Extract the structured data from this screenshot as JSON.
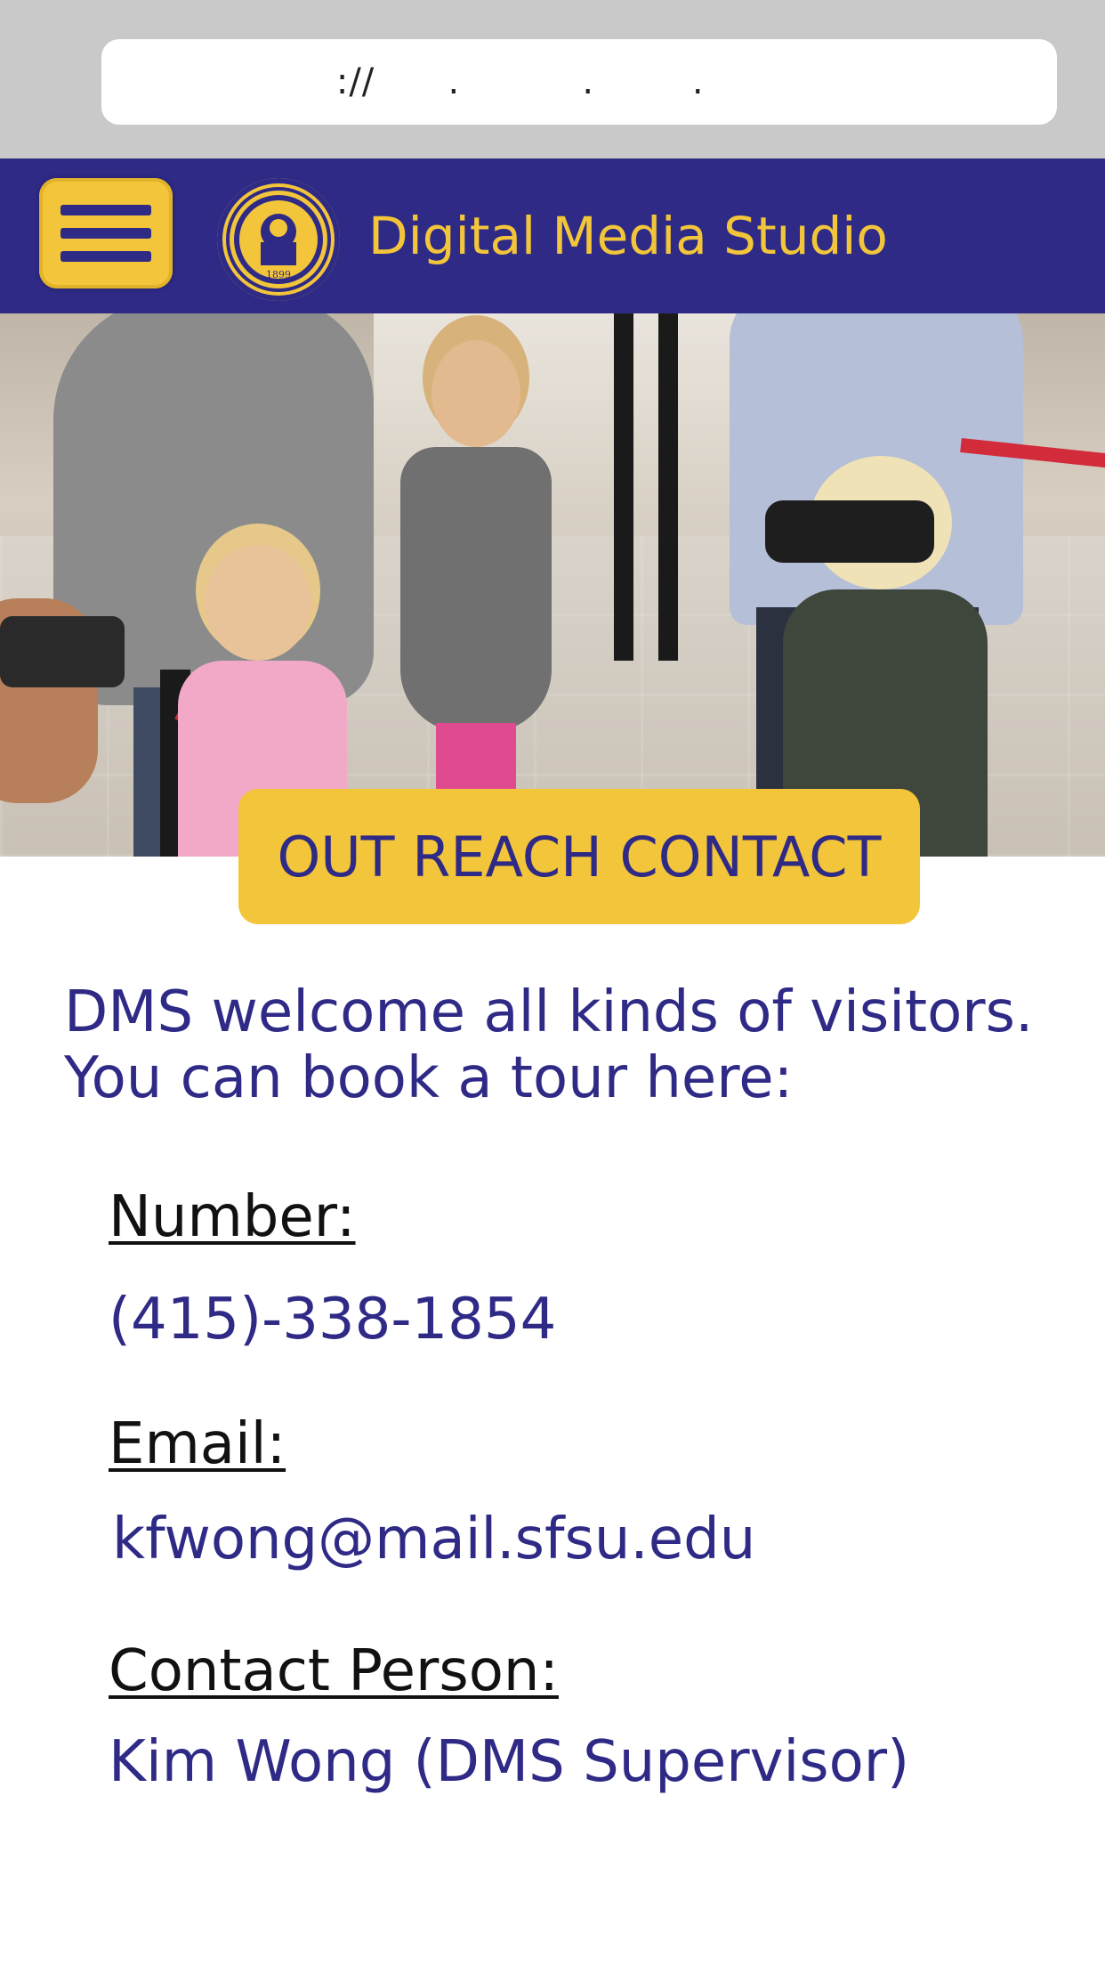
{
  "browser": {
    "address_text": "  ://      .          .        ."
  },
  "header": {
    "site_title": "Digital Media Studio",
    "logo_year": "1899",
    "menu_icon": "hamburger-menu-icon",
    "colors": {
      "header_bg": "#2e2a86",
      "accent": "#f2c53a"
    }
  },
  "banner": {
    "label": "OUT REACH CONTACT"
  },
  "content": {
    "intro_line1": "DMS welcome all kinds of visitors.",
    "intro_line2": "You can book a tour here:",
    "number_label": "Number:",
    "number_value": "(415)-338-1854",
    "email_label": "Email:",
    "email_value": "kfwong@mail.sfsu.edu",
    "contact_label": "Contact Person:",
    "contact_value": "Kim Wong (DMS Supervisor)"
  }
}
